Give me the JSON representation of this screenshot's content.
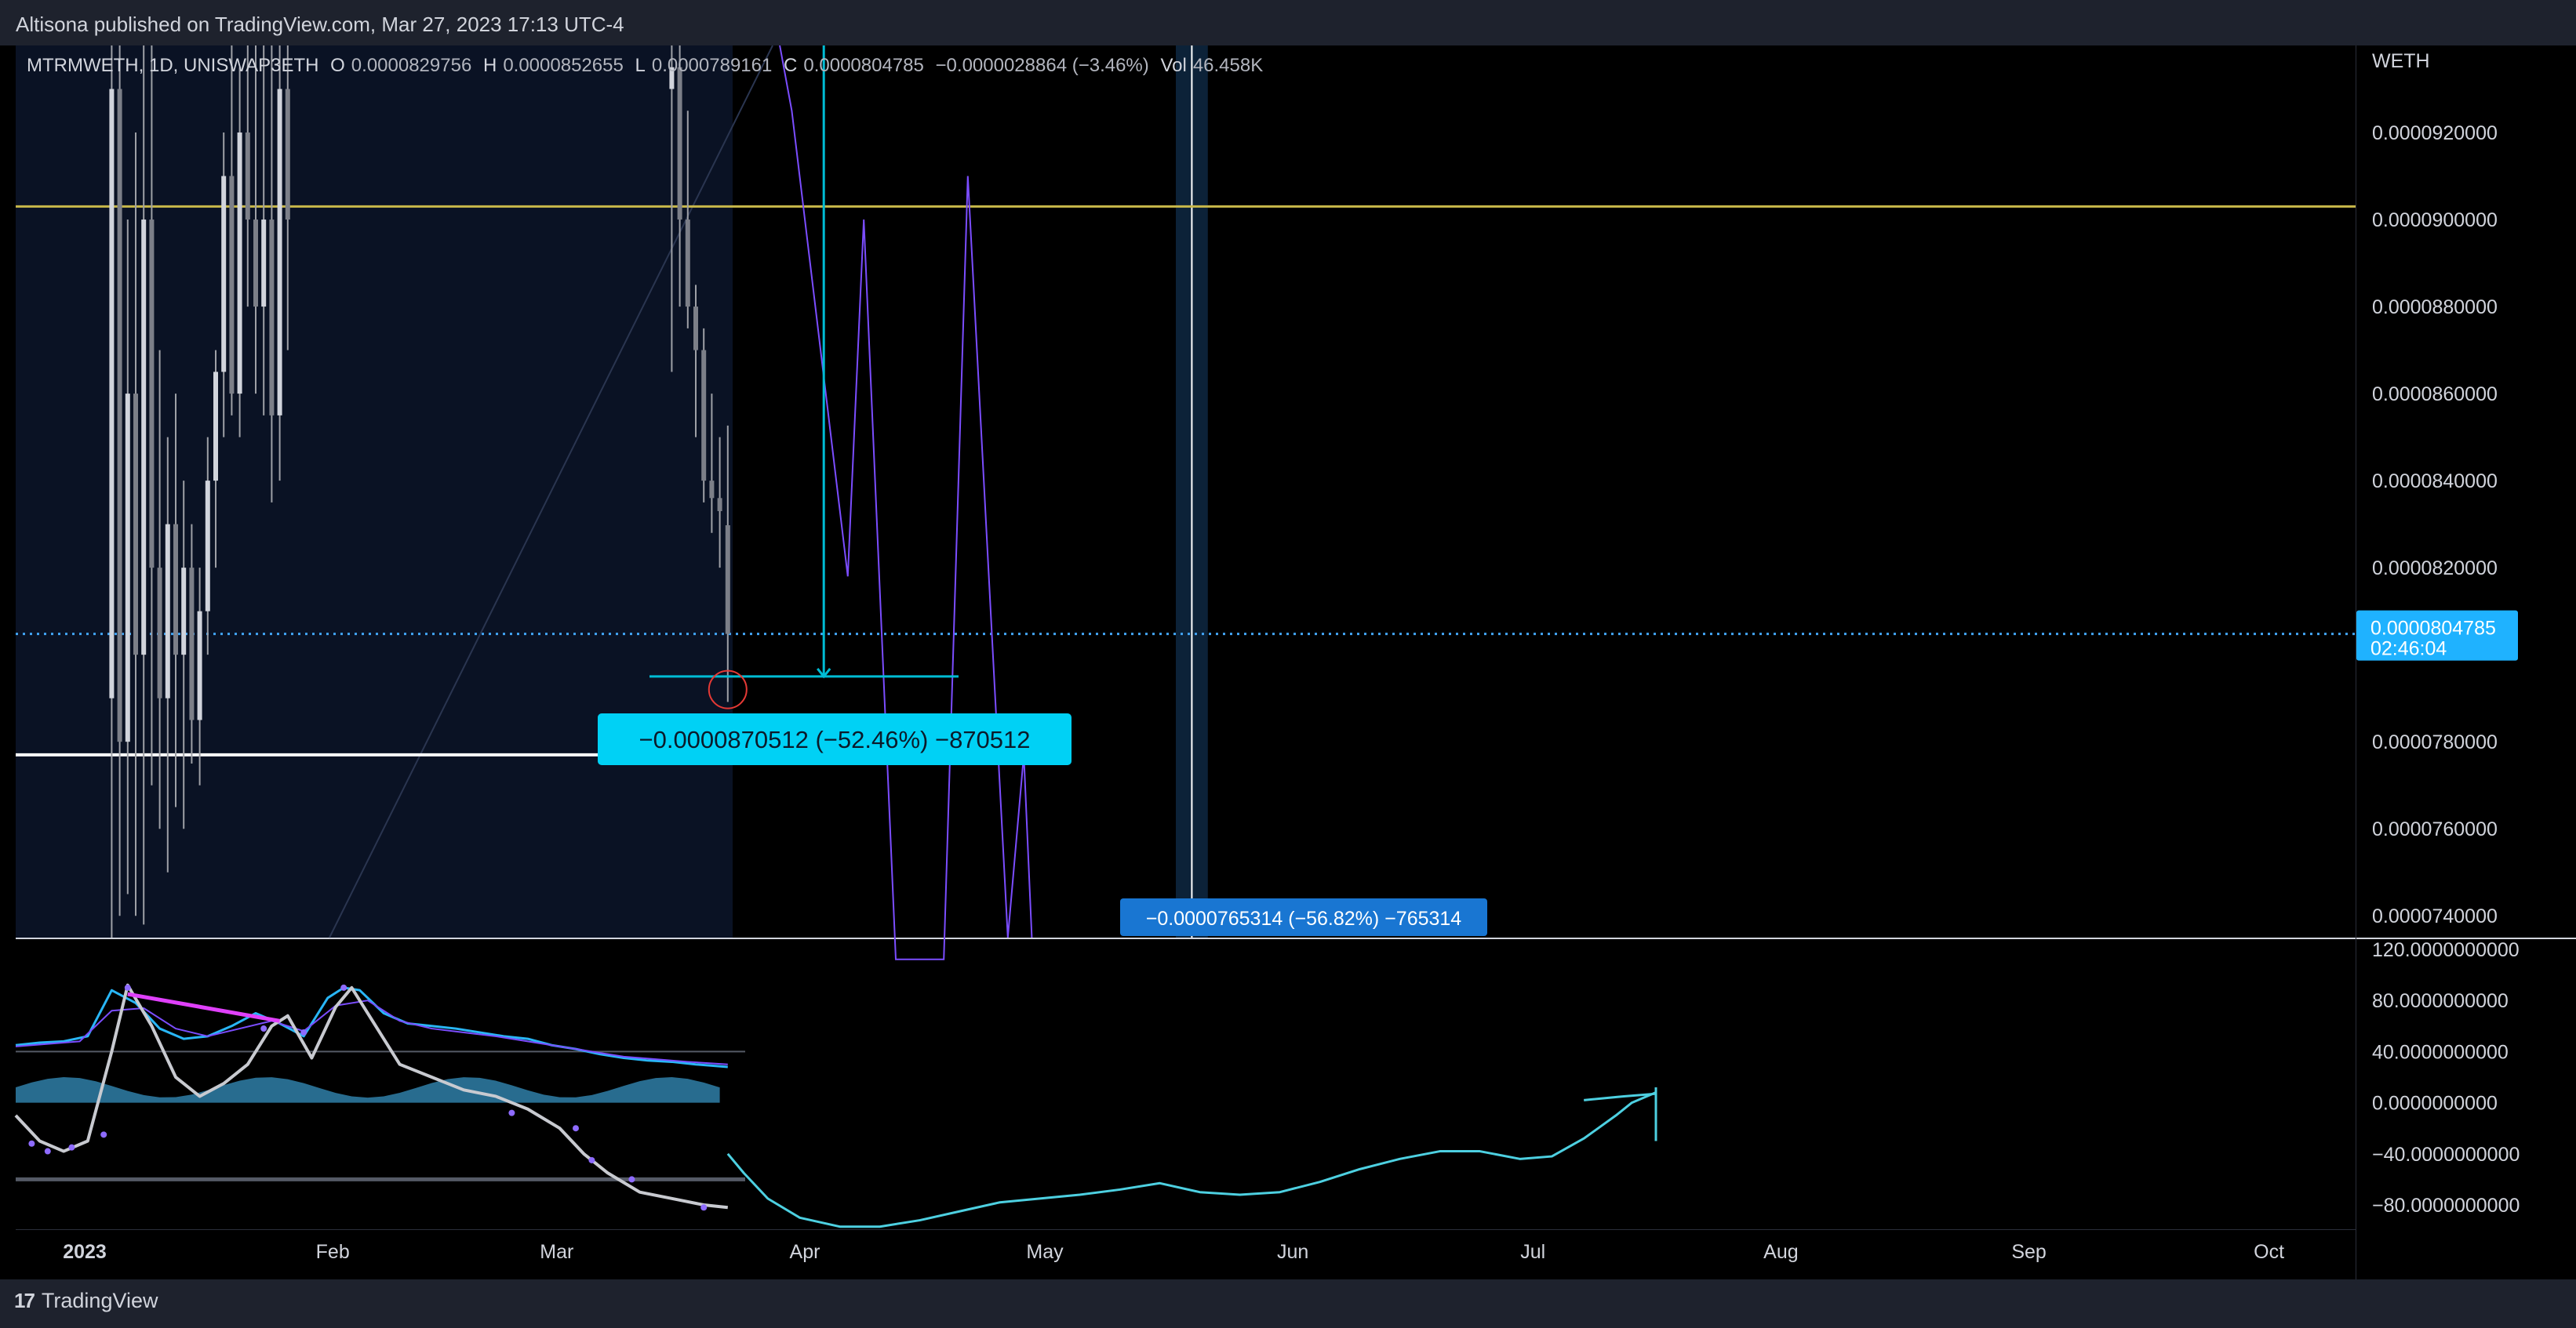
{
  "header": {
    "publisher": "Altisona published on TradingView.com, Mar 27, 2023 17:13 UTC-4"
  },
  "footer": {
    "brand": "TradingView",
    "logo_icon": "tradingview-logo-icon"
  },
  "legend": {
    "symbol": "MTRMWETH, 1D, UNISWAP3ETH",
    "o_label": "O",
    "o_value": "0.0000829756",
    "h_label": "H",
    "h_value": "0.0000852655",
    "l_label": "L",
    "l_value": "0.0000789161",
    "c_label": "C",
    "c_value": "0.0000804785",
    "change": "−0.0000028864 (−3.46%)",
    "vol_label": "Vol",
    "vol_value": "46.458K"
  },
  "colors": {
    "background": "#000000",
    "pane_shade": "#0a1224",
    "candle": "#9ea0a6",
    "accent_cyan": "#00bcd4",
    "measure_box": "#00d1f5",
    "measure_box2": "#1976d2",
    "price_line": "#42a5f5",
    "yellow_line": "#c8b84a",
    "purple_line": "#7b4dff",
    "highlight_band": "#0c2238",
    "indicator_cyan": "#4dd0e1",
    "magenta": "#e040fb",
    "red_circle": "#e53935"
  },
  "chart_data": [
    {
      "type": "candlestick",
      "title": "",
      "yaxis_label": "WETH",
      "ylim": [
        7.35e-05,
        9.4e-05
      ],
      "yticks": [
        "0.0000920000",
        "0.0000900000",
        "0.0000880000",
        "0.0000860000",
        "0.0000840000",
        "0.0000820000",
        "0.0000780000",
        "0.0000760000",
        "0.0000740000"
      ],
      "ytick_values": [
        9.2e-05,
        9e-05,
        8.8e-05,
        8.6e-05,
        8.4e-05,
        8.2e-05,
        7.8e-05,
        7.6e-05,
        7.4e-05
      ],
      "x_labels": [
        "2023",
        "Feb",
        "Mar",
        "Apr",
        "May",
        "Jun",
        "Jul",
        "Aug",
        "Sep",
        "Oct"
      ],
      "x_label_days": [
        0,
        31,
        59,
        90,
        120,
        151,
        181,
        212,
        243,
        273
      ],
      "last_price": "0.0000804785",
      "last_price_value": 8.04785e-05,
      "countdown": "02:46:04",
      "horizontal_lines": [
        {
          "name": "yellow",
          "value": 9.03e-05
        },
        {
          "name": "white",
          "value": 7.77e-05
        }
      ],
      "candles": [
        {
          "d": 12,
          "o": 7.9e-05,
          "h": 9.45e-05,
          "l": 7.35e-05,
          "c": 9.3e-05
        },
        {
          "d": 13,
          "o": 9.3e-05,
          "h": 9.45e-05,
          "l": 7.4e-05,
          "c": 7.8e-05
        },
        {
          "d": 14,
          "o": 7.8e-05,
          "h": 9e-05,
          "l": 7.45e-05,
          "c": 8.6e-05
        },
        {
          "d": 15,
          "o": 8.6e-05,
          "h": 9.2e-05,
          "l": 7.4e-05,
          "c": 8e-05
        },
        {
          "d": 16,
          "o": 8e-05,
          "h": 9.45e-05,
          "l": 7.38e-05,
          "c": 9e-05
        },
        {
          "d": 17,
          "o": 9e-05,
          "h": 9.45e-05,
          "l": 7.7e-05,
          "c": 8.2e-05
        },
        {
          "d": 18,
          "o": 8.2e-05,
          "h": 8.7e-05,
          "l": 7.6e-05,
          "c": 7.9e-05
        },
        {
          "d": 19,
          "o": 7.9e-05,
          "h": 8.5e-05,
          "l": 7.5e-05,
          "c": 8.3e-05
        },
        {
          "d": 20,
          "o": 8.3e-05,
          "h": 8.6e-05,
          "l": 7.65e-05,
          "c": 8e-05
        },
        {
          "d": 21,
          "o": 8e-05,
          "h": 8.4e-05,
          "l": 7.6e-05,
          "c": 8.2e-05
        },
        {
          "d": 22,
          "o": 8.2e-05,
          "h": 8.3e-05,
          "l": 7.75e-05,
          "c": 7.85e-05
        },
        {
          "d": 23,
          "o": 7.85e-05,
          "h": 8.2e-05,
          "l": 7.7e-05,
          "c": 8.1e-05
        },
        {
          "d": 24,
          "o": 8.1e-05,
          "h": 8.5e-05,
          "l": 8e-05,
          "c": 8.4e-05
        },
        {
          "d": 25,
          "o": 8.4e-05,
          "h": 8.7e-05,
          "l": 8.2e-05,
          "c": 8.65e-05
        },
        {
          "d": 26,
          "o": 8.65e-05,
          "h": 9.2e-05,
          "l": 8.5e-05,
          "c": 9.1e-05
        },
        {
          "d": 27,
          "o": 9.1e-05,
          "h": 9.4e-05,
          "l": 8.55e-05,
          "c": 8.6e-05
        },
        {
          "d": 28,
          "o": 8.6e-05,
          "h": 9.35e-05,
          "l": 8.5e-05,
          "c": 9.2e-05
        },
        {
          "d": 29,
          "o": 9.2e-05,
          "h": 9.45e-05,
          "l": 8.8e-05,
          "c": 9e-05
        },
        {
          "d": 30,
          "o": 9e-05,
          "h": 9.45e-05,
          "l": 8.6e-05,
          "c": 8.8e-05
        },
        {
          "d": 31,
          "o": 8.8e-05,
          "h": 9.4e-05,
          "l": 8.55e-05,
          "c": 9e-05
        },
        {
          "d": 32,
          "o": 9e-05,
          "h": 9.45e-05,
          "l": 8.35e-05,
          "c": 8.55e-05
        },
        {
          "d": 33,
          "o": 8.55e-05,
          "h": 9.45e-05,
          "l": 8.4e-05,
          "c": 9.3e-05
        },
        {
          "d": 34,
          "o": 9.3e-05,
          "h": 9.45e-05,
          "l": 8.7e-05,
          "c": 9e-05
        },
        {
          "d": 82,
          "o": 9.3e-05,
          "h": 9.45e-05,
          "l": 8.65e-05,
          "c": 9.35e-05
        },
        {
          "d": 83,
          "o": 9.35e-05,
          "h": 9.45e-05,
          "l": 8.8e-05,
          "c": 9e-05
        },
        {
          "d": 84,
          "o": 9e-05,
          "h": 9.25e-05,
          "l": 8.75e-05,
          "c": 8.8e-05
        },
        {
          "d": 85,
          "o": 8.8e-05,
          "h": 8.85e-05,
          "l": 8.5e-05,
          "c": 8.7e-05
        },
        {
          "d": 86,
          "o": 8.7e-05,
          "h": 8.75e-05,
          "l": 8.35e-05,
          "c": 8.4e-05
        },
        {
          "d": 87,
          "o": 8.4e-05,
          "h": 8.6e-05,
          "l": 8.28e-05,
          "c": 8.36e-05
        },
        {
          "d": 88,
          "o": 8.36e-05,
          "h": 8.5e-05,
          "l": 8.2e-05,
          "c": 8.33e-05
        },
        {
          "d": 89,
          "o": 8.29756e-05,
          "h": 8.52655e-05,
          "l": 7.89161e-05,
          "c": 8.04785e-05
        }
      ],
      "purple_path": [
        {
          "d": 95,
          "v": 9.45e-05
        },
        {
          "d": 97,
          "v": 9.25e-05
        },
        {
          "d": 104,
          "v": 8.18e-05
        },
        {
          "d": 106,
          "v": 9e-05
        },
        {
          "d": 110,
          "v": 7.3e-05
        },
        {
          "d": 116,
          "v": 7.3e-05
        },
        {
          "d": 119,
          "v": 9.1e-05
        },
        {
          "d": 124,
          "v": 7.35e-05
        },
        {
          "d": 126,
          "v": 7.77e-05
        },
        {
          "d": 127,
          "v": 7.35e-05
        }
      ],
      "measure_1": {
        "label": "−0.0000870512 (−52.46%) −870512",
        "start_day": 90,
        "end_day": 110,
        "arrow_day": 101,
        "from_value": 9.45e-05,
        "to_value": 7.95e-05
      },
      "measure_2": {
        "label": "−0.0000765314 (−56.82%) −765314",
        "start_day": 144,
        "end_day": 148
      },
      "highlight_band": {
        "start_day": 145,
        "end_day": 149
      },
      "vertical_line_day": 147,
      "circle_marker": {
        "day": 89,
        "value": 7.92e-05
      }
    },
    {
      "type": "line",
      "title": "",
      "ylim": [
        -100,
        120
      ],
      "yticks": [
        "120.0000000000",
        "80.0000000000",
        "40.0000000000",
        "0.0000000000",
        "−40.0000000000",
        "−80.0000000000"
      ],
      "ytick_values": [
        120,
        80,
        40,
        0,
        -40,
        -80
      ],
      "reference_lines": [
        40,
        -60
      ],
      "series": [
        {
          "key": "cyan_oscillator",
          "points": [
            [
              0,
              45
            ],
            [
              3,
              47
            ],
            [
              6,
              48
            ],
            [
              9,
              52
            ],
            [
              12,
              88
            ],
            [
              15,
              78
            ],
            [
              18,
              58
            ],
            [
              21,
              50
            ],
            [
              24,
              52
            ],
            [
              27,
              60
            ],
            [
              30,
              70
            ],
            [
              33,
              62
            ],
            [
              36,
              52
            ],
            [
              39,
              82
            ],
            [
              41,
              90
            ],
            [
              43,
              88
            ],
            [
              46,
              70
            ],
            [
              49,
              62
            ],
            [
              52,
              60
            ],
            [
              55,
              58
            ],
            [
              58,
              55
            ],
            [
              61,
              52
            ],
            [
              64,
              50
            ],
            [
              67,
              45
            ],
            [
              70,
              42
            ],
            [
              73,
              38
            ],
            [
              76,
              35
            ],
            [
              79,
              33
            ],
            [
              82,
              32
            ],
            [
              85,
              30
            ],
            [
              89,
              28
            ]
          ]
        },
        {
          "key": "purple_signal",
          "points": [
            [
              0,
              44
            ],
            [
              4,
              46
            ],
            [
              8,
              48
            ],
            [
              12,
              72
            ],
            [
              16,
              74
            ],
            [
              20,
              58
            ],
            [
              24,
              52
            ],
            [
              28,
              58
            ],
            [
              32,
              64
            ],
            [
              36,
              56
            ],
            [
              40,
              76
            ],
            [
              44,
              80
            ],
            [
              48,
              64
            ],
            [
              52,
              58
            ],
            [
              56,
              55
            ],
            [
              60,
              52
            ],
            [
              64,
              48
            ],
            [
              68,
              44
            ],
            [
              72,
              40
            ],
            [
              76,
              36
            ],
            [
              80,
              34
            ],
            [
              84,
              32
            ],
            [
              89,
              30
            ]
          ]
        },
        {
          "key": "white_wave",
          "points": [
            [
              0,
              -10
            ],
            [
              3,
              -30
            ],
            [
              6,
              -38
            ],
            [
              9,
              -30
            ],
            [
              12,
              40
            ],
            [
              14,
              92
            ],
            [
              17,
              60
            ],
            [
              20,
              20
            ],
            [
              23,
              5
            ],
            [
              26,
              15
            ],
            [
              29,
              30
            ],
            [
              32,
              60
            ],
            [
              34,
              68
            ],
            [
              37,
              35
            ],
            [
              40,
              75
            ],
            [
              42,
              90
            ],
            [
              45,
              60
            ],
            [
              48,
              30
            ],
            [
              52,
              20
            ],
            [
              56,
              10
            ],
            [
              60,
              5
            ],
            [
              64,
              -5
            ],
            [
              68,
              -20
            ],
            [
              71,
              -40
            ],
            [
              74,
              -55
            ],
            [
              78,
              -70
            ],
            [
              82,
              -75
            ],
            [
              86,
              -80
            ],
            [
              89,
              -82
            ]
          ]
        },
        {
          "key": "projection",
          "points": [
            [
              89,
              -40
            ],
            [
              91,
              -55
            ],
            [
              94,
              -75
            ],
            [
              98,
              -90
            ],
            [
              103,
              -97
            ],
            [
              108,
              -97
            ],
            [
              113,
              -92
            ],
            [
              118,
              -85
            ],
            [
              123,
              -78
            ],
            [
              128,
              -75
            ],
            [
              133,
              -72
            ],
            [
              138,
              -68
            ],
            [
              143,
              -63
            ],
            [
              148,
              -70
            ],
            [
              153,
              -72
            ],
            [
              158,
              -70
            ],
            [
              163,
              -62
            ],
            [
              168,
              -52
            ],
            [
              173,
              -44
            ],
            [
              178,
              -38
            ],
            [
              183,
              -38
            ],
            [
              188,
              -44
            ],
            [
              192,
              -42
            ],
            [
              196,
              -28
            ],
            [
              200,
              -10
            ],
            [
              202,
              0
            ],
            [
              205,
              8
            ]
          ]
        },
        {
          "key": "projection_tail",
          "points": [
            [
              196,
              2
            ],
            [
              201,
              5
            ],
            [
              205,
              7
            ]
          ]
        }
      ],
      "divergence_line": {
        "from": [
          14,
          85
        ],
        "to": [
          33,
          64
        ]
      }
    }
  ]
}
